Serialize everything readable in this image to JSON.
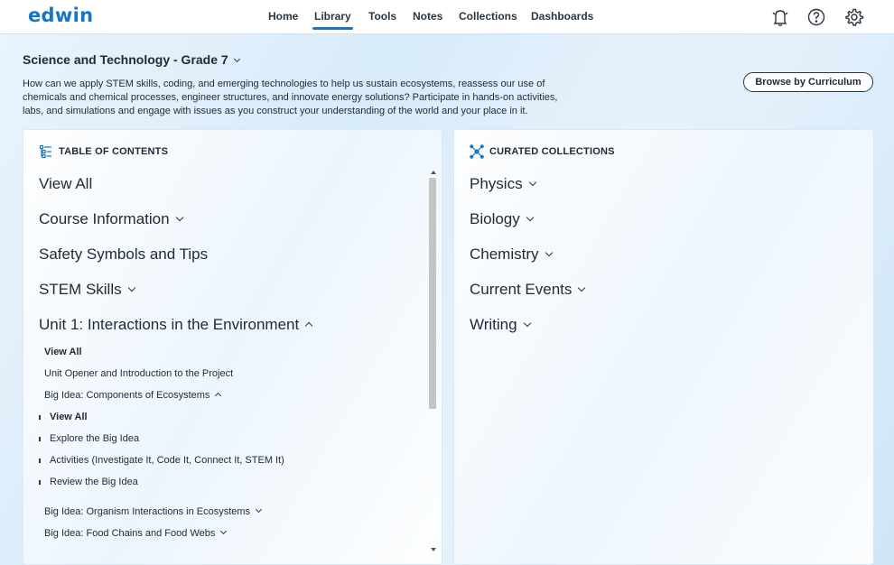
{
  "app": {
    "logo": "edwin",
    "brand_color": "#1676c5"
  },
  "nav": {
    "items": [
      {
        "label": "Home",
        "active": false
      },
      {
        "label": "Library",
        "active": true
      },
      {
        "label": "Tools",
        "active": false
      },
      {
        "label": "Notes",
        "active": false
      },
      {
        "label": "Collections",
        "active": false
      },
      {
        "label": "Dashboards",
        "active": false
      }
    ],
    "icons": [
      "notification-bell-icon",
      "help-icon",
      "settings-gear-icon"
    ]
  },
  "course": {
    "title": "Science and Technology - Grade 7",
    "description": "How can we apply STEM skills, coding, and emerging technologies to help us sustain ecosystems, reassess our use of chemicals and chemical processes, engineer structures, and innovate energy solutions? Participate in hands-on activities, labs, and simulations and engage with issues as you construct your understanding of the world and your place in it.",
    "browse_button": "Browse by Curriculum"
  },
  "toc": {
    "heading": "TABLE OF CONTENTS",
    "items": [
      {
        "label": "View All"
      },
      {
        "label": "Course Information"
      },
      {
        "label": "Safety Symbols and Tips"
      },
      {
        "label": "STEM Skills"
      },
      {
        "label": "Unit 1: Interactions in the Environment"
      }
    ],
    "unit1": {
      "view_all": "View All",
      "opener": "Unit Opener and Introduction to the Project",
      "big_idea_1": "Big Idea: Components of Ecosystems",
      "big_idea_1_children": [
        "View All",
        "Explore the Big Idea",
        "Activities (Investigate It, Code It, Connect It, STEM It)",
        "Review the Big Idea"
      ],
      "big_idea_2": "Big Idea: Organism Interactions in Ecosystems",
      "big_idea_3": "Big Idea: Food Chains and Food Webs"
    }
  },
  "collections": {
    "heading": "CURATED COLLECTIONS",
    "items": [
      "Physics",
      "Biology",
      "Chemistry",
      "Current Events",
      "Writing"
    ]
  }
}
